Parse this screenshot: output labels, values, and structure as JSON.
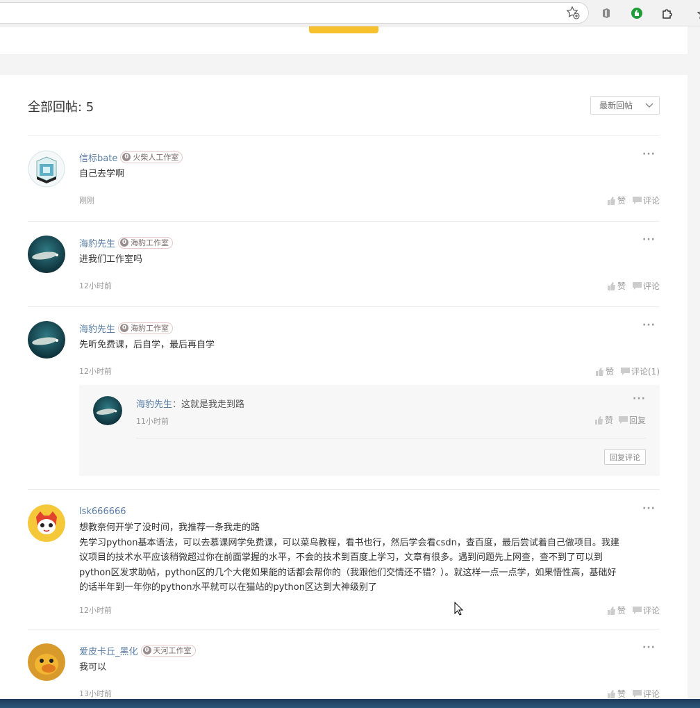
{
  "browser": {
    "icons": [
      "star-add-icon",
      "office-extension-icon",
      "green-extension-icon",
      "puzzle-icon"
    ]
  },
  "thread": {
    "title": "全部回帖: 5",
    "sort_label": "最新回帖"
  },
  "actions": {
    "like": "赞",
    "comment": "评论",
    "reply": "回复",
    "reply_comment_button": "回复评论",
    "more": "···"
  },
  "posts": [
    {
      "author": "信标bate",
      "level": "0",
      "studio": "火柴人工作室",
      "content": "自己去学啊",
      "time": "刚刚",
      "comment_label": "评论"
    },
    {
      "author": "海豹先生",
      "level": "0",
      "studio": "海豹工作室",
      "content": "进我们工作室吗",
      "time": "12小时前",
      "comment_label": "评论"
    },
    {
      "author": "海豹先生",
      "level": "0",
      "studio": "海豹工作室",
      "content": "先听免费课，后自学，最后再自学",
      "time": "12小时前",
      "comment_label": "评论(1)",
      "reply": {
        "author": "海豹先生",
        "separator": "：",
        "content": "这就是我走到路",
        "time": "11小时前"
      }
    },
    {
      "author": "lsk666666",
      "content_lines": [
        "想教奈何开学了没时间，我推荐一条我走的路",
        "先学习python基本语法，可以去慕课网学免费课，可以菜鸟教程，看书也行，然后学会看csdn，查百度，最后尝试着自己做项目。我建",
        "议项目的技术水平应该稍微超过你在前面掌握的水平，不会的技术到百度上学习，文章有很多。遇到问题先上网查，查不到了可以到",
        "python区发求助帖，python区的几个大佬如果能的话都会帮你的（我跟他们交情还不错？）。就这样一点一点学，如果悟性高，基础好",
        "的话半年到一年你的python水平就可以在猫站的python区达到大神级别了"
      ],
      "time": "12小时前",
      "comment_label": "评论"
    },
    {
      "author": "爱皮卡丘_黑化",
      "level": "0",
      "studio": "天河工作室",
      "content": "我可以",
      "time": "13小时前",
      "comment_label": "评论"
    }
  ]
}
